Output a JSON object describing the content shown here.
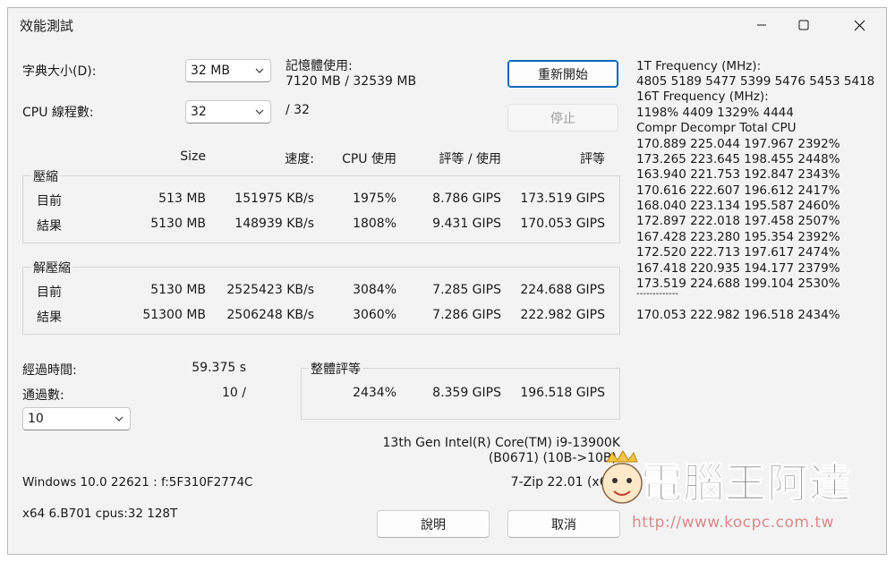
{
  "window": {
    "title": "效能測試"
  },
  "settings": {
    "dict_label": "字典大小(D):",
    "dict_value": "32 MB",
    "threads_label": "CPU 線程數:",
    "threads_value": "32",
    "threads_max": "/ 32",
    "mem_label": "記憶體使用:",
    "mem_value": "7120 MB / 32539 MB"
  },
  "buttons": {
    "restart": "重新開始",
    "stop": "停止",
    "help": "說明",
    "cancel": "取消"
  },
  "columns": {
    "size": "Size",
    "speed": "速度:",
    "cpu": "CPU 使用",
    "rating_usage": "評等 / 使用",
    "rating": "評等"
  },
  "compress": {
    "title": "壓縮",
    "rows": [
      {
        "label": "目前",
        "size": "513 MB",
        "speed": "151975 KB/s",
        "cpu": "1975%",
        "rpu": "8.786 GIPS",
        "rating": "173.519 GIPS"
      },
      {
        "label": "結果",
        "size": "5130 MB",
        "speed": "148939 KB/s",
        "cpu": "1808%",
        "rpu": "9.431 GIPS",
        "rating": "170.053 GIPS"
      }
    ]
  },
  "decompress": {
    "title": "解壓縮",
    "rows": [
      {
        "label": "目前",
        "size": "5130 MB",
        "speed": "2525423 KB/s",
        "cpu": "3084%",
        "rpu": "7.285 GIPS",
        "rating": "224.688 GIPS"
      },
      {
        "label": "結果",
        "size": "51300 MB",
        "speed": "2506248 KB/s",
        "cpu": "3060%",
        "rpu": "7.286 GIPS",
        "rating": "222.982 GIPS"
      }
    ]
  },
  "elapsed": {
    "label": "經過時間:",
    "value": "59.375 s"
  },
  "passes": {
    "label": "通過數:",
    "value": "10 /",
    "select": "10"
  },
  "total": {
    "title": "整體評等",
    "cpu": "2434%",
    "rpu": "8.359 GIPS",
    "rating": "196.518 GIPS"
  },
  "cpu_info": {
    "line1": "13th Gen Intel(R) Core(TM) i9-13900K",
    "line2": "(B0671) (10B->10B)"
  },
  "version": "7-Zip 22.01 (x64)",
  "os": {
    "windows": "Windows 10.0 22621 : f:5F310F2774C",
    "arch": "x64 6.B701 cpus:32 128T"
  },
  "log": [
    "1T Frequency (MHz):",
    " 4805 5189 5477 5399 5476 5453 5418",
    "16T Frequency (MHz):",
    " 1198% 4409 1329% 4444",
    "Compr Decompr Total   CPU",
    "170.889  225.044  197.967  2392%",
    "173.265  223.645  198.455  2448%",
    "163.940  221.753  192.847  2343%",
    "170.616  222.607  196.612  2417%",
    "168.040  223.134  195.587  2460%",
    "172.897  222.018  197.458  2507%",
    "167.428  223.280  195.354  2392%",
    "172.520  222.713  197.617  2474%",
    "167.418  220.935  194.177  2379%",
    "173.519  224.688  199.104  2530%",
    "-------------",
    "170.053  222.982  196.518  2434%"
  ],
  "watermark": {
    "name": "電腦王阿達",
    "url": "http://www.kocpc.com.tw"
  },
  "colors": {
    "accent": "#0067c0",
    "watermark": "#7a7a7a",
    "watermark_url": "#d98a8a"
  }
}
